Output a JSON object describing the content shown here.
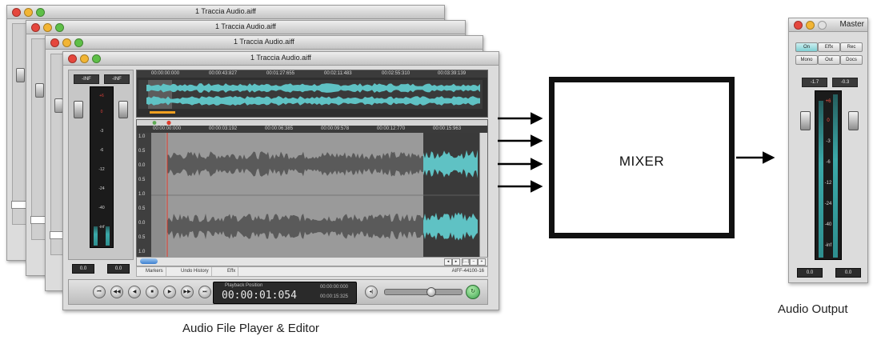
{
  "windows": {
    "back_titles": [
      "1 Traccia Audio.aiff",
      "1 Traccia Audio.aiff",
      "1 Traccia Audio.aiff"
    ],
    "front_title": "1 Traccia Audio.aiff"
  },
  "player": {
    "vu_peak_left": "-INF",
    "vu_peak_right": "-INF",
    "vu_scale": [
      "+6",
      "0",
      "-3",
      "-6",
      "-12",
      "-24",
      "-40",
      "-inf"
    ],
    "vu_value_left": "0.0",
    "vu_value_right": "0.0",
    "overview_timeline": [
      "00:00:00:000",
      "00:00:43:827",
      "00:01:27:655",
      "00:02:11:483",
      "00:02:55:310",
      "00:03:39:139"
    ],
    "editor_timeline": [
      "00:00:00:000",
      "00:00:03:192",
      "00:00:06:385",
      "00:00:09:578",
      "00:00:12:770",
      "00:00:15:963"
    ],
    "amp_scale": [
      "1.0",
      "0.5",
      "0.0",
      "0.5",
      "1.0",
      "0.5",
      "0.0",
      "0.5",
      "1.0"
    ],
    "tabs": [
      "Markers",
      "Undo History",
      "Effx"
    ],
    "format": "AIFF-44100-16",
    "playback_label": "Playback Position",
    "playback_time": "00:00:01:054",
    "time_start": "00:00:00:000",
    "time_end": "00:00:15:325",
    "transport_icons": [
      "skip-start-icon",
      "rewind-icon",
      "step-back-icon",
      "stop-icon",
      "play-icon",
      "step-forward-icon",
      "skip-end-icon"
    ]
  },
  "mixer": {
    "label": "MIXER"
  },
  "master": {
    "title": "Master",
    "buttons_row1": [
      "On",
      "Effx",
      "Rec"
    ],
    "buttons_row2": [
      "Mono",
      "Out",
      "Docs"
    ],
    "peak_left": "-1.7",
    "peak_right": "-0.3",
    "scale": [
      "+6",
      "0",
      "-3",
      "-6",
      "-12",
      "-24",
      "-40",
      "-inf"
    ],
    "value_left": "0.0",
    "value_right": "0.0"
  },
  "captions": {
    "player": "Audio File Player & Editor",
    "output": "Audio Output"
  },
  "colors": {
    "waveform": "#5a5a5a",
    "waveform_selected": "#5fc2c4",
    "playhead": "#e03a2a",
    "meter_fill": "#3ba9a9"
  }
}
